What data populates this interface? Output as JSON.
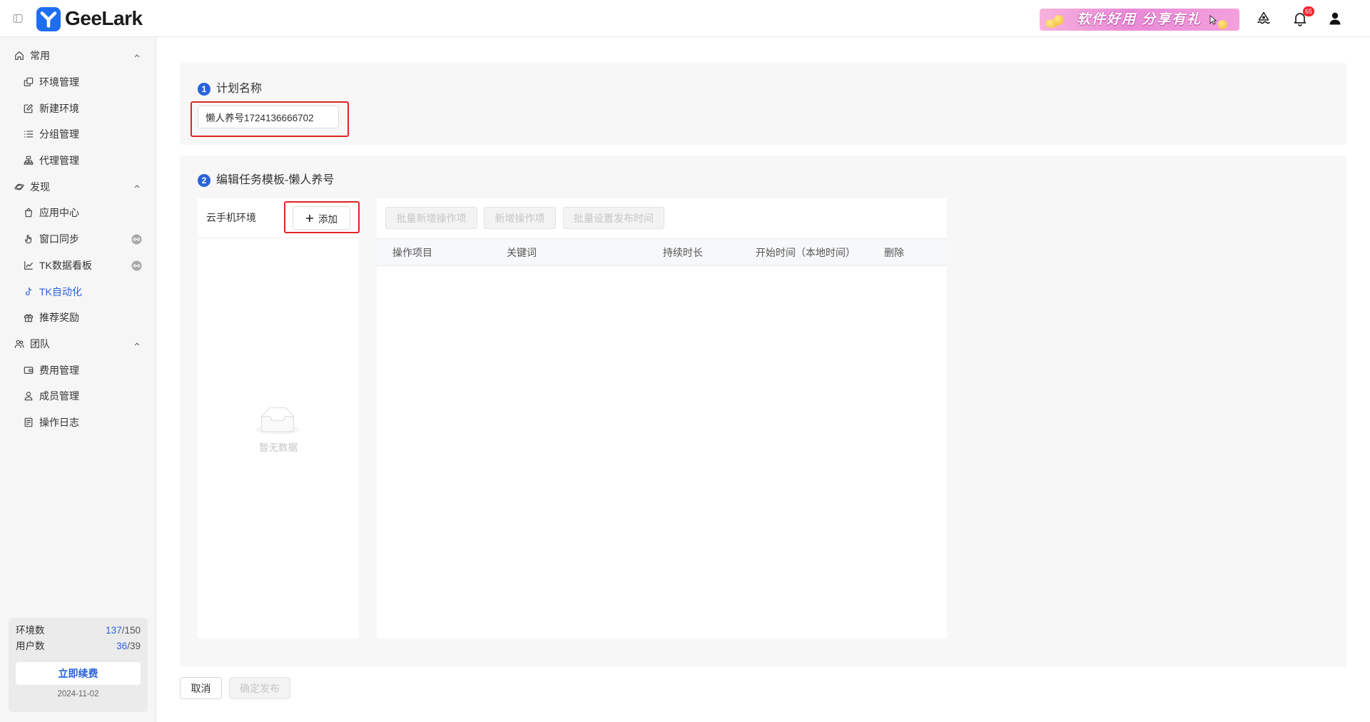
{
  "app": {
    "name": "GeeLark"
  },
  "header": {
    "promo_banner": "软件好用 分享有礼",
    "notification_count": "65",
    "icons": [
      "sidebar-toggle-icon",
      "ship-icon",
      "bell-icon",
      "user-icon"
    ]
  },
  "sidebar": {
    "groups": [
      {
        "label": "常用",
        "icon": "home-icon",
        "items": [
          {
            "label": "环境管理",
            "icon": "copy-icon"
          },
          {
            "label": "新建环境",
            "icon": "edit-icon"
          },
          {
            "label": "分组管理",
            "icon": "list-icon"
          },
          {
            "label": "代理管理",
            "icon": "network-icon"
          }
        ]
      },
      {
        "label": "发现",
        "icon": "planet-icon",
        "items": [
          {
            "label": "应用中心",
            "icon": "app-store-icon"
          },
          {
            "label": "窗口同步",
            "icon": "hand-pointer-icon"
          },
          {
            "label": "TK数据看板",
            "icon": "line-chart-icon"
          },
          {
            "label": "TK自动化",
            "icon": "tiktok-icon",
            "active": true
          },
          {
            "label": "推荐奖励",
            "icon": "gift-icon"
          }
        ]
      },
      {
        "label": "团队",
        "icon": "team-icon",
        "items": [
          {
            "label": "费用管理",
            "icon": "wallet-icon"
          },
          {
            "label": "成员管理",
            "icon": "member-icon"
          },
          {
            "label": "操作日志",
            "icon": "log-icon"
          }
        ]
      }
    ],
    "stats": {
      "env_label": "环境数",
      "env_used": "137",
      "env_limit": "150",
      "user_label": "用户数",
      "user_used": "36",
      "user_limit": "39",
      "separator": "/",
      "renew_label": "立即续费",
      "expiry_date": "2024-11-02"
    }
  },
  "plan_name": {
    "step": "1",
    "title": "计划名称",
    "value": "懒人养号1724136666702"
  },
  "template": {
    "step": "2",
    "title": "编辑任务模板-懒人养号",
    "env_panel": {
      "title": "云手机环境",
      "add_label": "添加",
      "empty_text": "暂无数据"
    },
    "toolbar": {
      "batch_add_label": "批量新增操作项",
      "add_label": "新增操作项",
      "batch_time_label": "批量设置发布时间"
    },
    "table": {
      "columns": [
        "操作项目",
        "关键词",
        "持续时长",
        "开始时间（本地时间）",
        "删除"
      ]
    }
  },
  "footer": {
    "cancel_label": "取消",
    "publish_label": "确定发布"
  },
  "colors": {
    "accent": "#2a62d9",
    "logo": "#1f6ef2",
    "highlight": "#e02424",
    "badge": "#f5222d"
  }
}
